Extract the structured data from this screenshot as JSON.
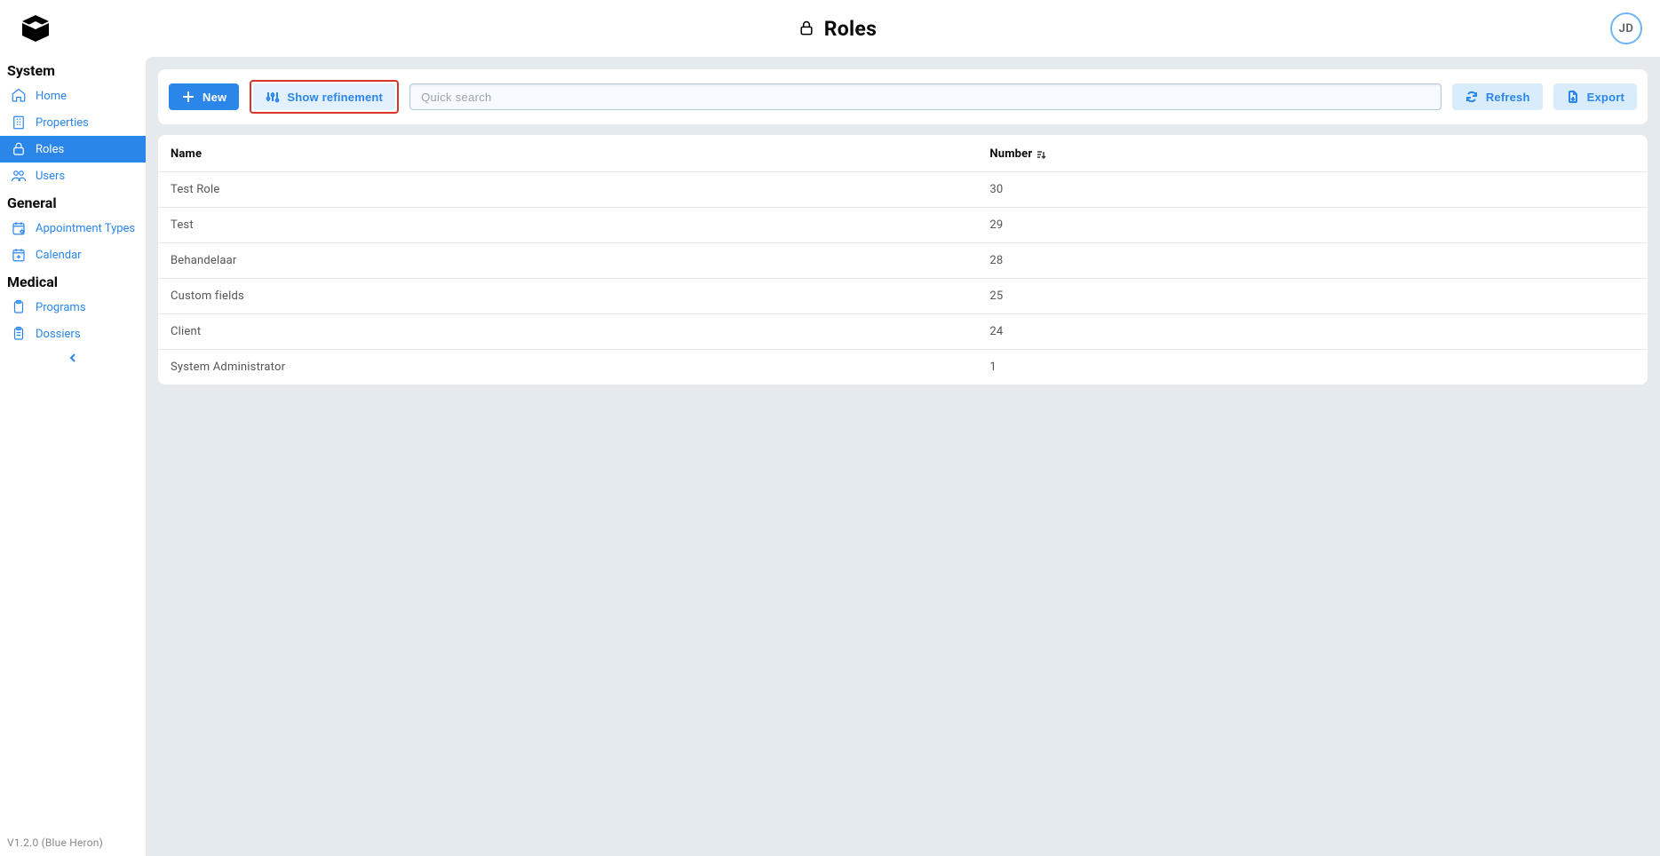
{
  "header": {
    "title": "Roles",
    "avatar_initials": "JD"
  },
  "sidebar": {
    "groups": [
      {
        "title": "System",
        "items": [
          {
            "key": "home",
            "label": "Home",
            "icon": "home-icon",
            "active": false
          },
          {
            "key": "properties",
            "label": "Properties",
            "icon": "building-icon",
            "active": false
          },
          {
            "key": "roles",
            "label": "Roles",
            "icon": "lock-icon",
            "active": true
          },
          {
            "key": "users",
            "label": "Users",
            "icon": "users-icon",
            "active": false
          }
        ]
      },
      {
        "title": "General",
        "items": [
          {
            "key": "appointment-types",
            "label": "Appointment Types",
            "icon": "calendar-cog-icon",
            "active": false
          },
          {
            "key": "calendar",
            "label": "Calendar",
            "icon": "calendar-plus-icon",
            "active": false
          }
        ]
      },
      {
        "title": "Medical",
        "items": [
          {
            "key": "programs",
            "label": "Programs",
            "icon": "clipboard-icon",
            "active": false
          },
          {
            "key": "dossiers",
            "label": "Dossiers",
            "icon": "clipboard-list-icon",
            "active": false
          }
        ]
      }
    ],
    "version": "V1.2.0 (Blue Heron)"
  },
  "toolbar": {
    "new_label": "New",
    "show_refinement_label": "Show refinement",
    "search_placeholder": "Quick search",
    "refresh_label": "Refresh",
    "export_label": "Export"
  },
  "table": {
    "columns": [
      {
        "key": "name",
        "label": "Name",
        "sorted": false
      },
      {
        "key": "number",
        "label": "Number",
        "sorted": true
      }
    ],
    "rows": [
      {
        "name": "Test Role",
        "number": "30"
      },
      {
        "name": "Test",
        "number": "29"
      },
      {
        "name": "Behandelaar",
        "number": "28"
      },
      {
        "name": "Custom fields",
        "number": "25"
      },
      {
        "name": "Client",
        "number": "24"
      },
      {
        "name": "System Administrator",
        "number": "1"
      }
    ]
  }
}
